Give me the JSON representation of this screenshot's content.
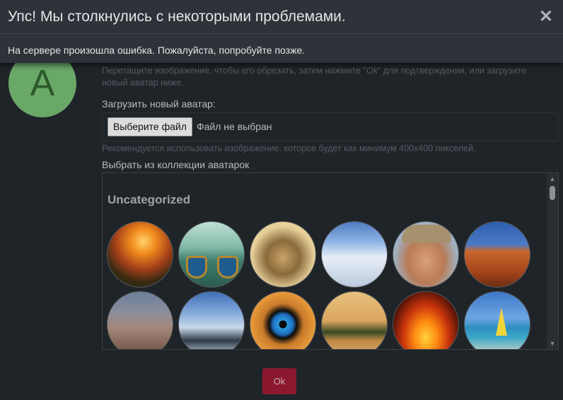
{
  "alert": {
    "title": "Упс! Мы столкнулись с некоторыми проблемами.",
    "close_glyph": "✕",
    "message": "На сервере произошла ошибка. Пожалуйста, попробуйте позже."
  },
  "avatar": {
    "letter": "A",
    "color": "#6aa868"
  },
  "hints": {
    "crop_part1": "Перетащите изображение, чтобы его обрезать, затем нажмите \"",
    "crop_ok": "Ok",
    "crop_part2": "\" для подтверждения, или загрузите новый аватар ниже.",
    "recommend": "Рекомендуется использовать изображение, которое будет как минимум 400x400 пикселей."
  },
  "upload": {
    "label": "Загрузить новый аватар:",
    "button": "Выберите файл",
    "status": "Файл не выбран"
  },
  "collection": {
    "label": "Выбрать из коллекции аватарок",
    "category": "Uncategorized",
    "avatars": [
      "sunset-landscape",
      "boats-on-lake",
      "tribal-warrior-art",
      "snowy-mountains",
      "man-in-beanie",
      "desert-dunes",
      "rocky-shore",
      "winter-forest",
      "blue-eye",
      "desert-palms",
      "fire-letters",
      "beach-sailboat"
    ]
  },
  "footer": {
    "ok_label": "Ok",
    "ok_color": "#8c1830"
  }
}
